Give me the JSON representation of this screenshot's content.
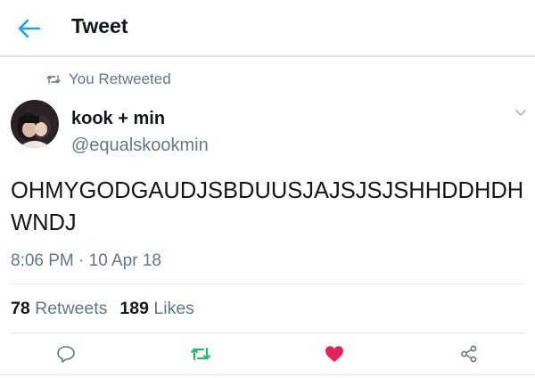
{
  "header": {
    "title": "Tweet",
    "back_icon": "arrow-left-icon"
  },
  "retweet_context": {
    "text": "You Retweeted",
    "icon": "retweet-icon"
  },
  "author": {
    "display_name": "kook + min",
    "handle": "@equalskookmin"
  },
  "tweet": {
    "text": "OHMYGODGAUDJSBDUUSJAJSJSJSHHDDHDHWNDJ",
    "timestamp": "8:06 PM · 10 Apr 18"
  },
  "stats": {
    "retweets_count": "78",
    "retweets_label": "Retweets",
    "likes_count": "189",
    "likes_label": "Likes"
  },
  "actions": [
    {
      "name": "reply",
      "icon": "reply-icon",
      "active": false
    },
    {
      "name": "retweet",
      "icon": "retweet-icon",
      "active": true
    },
    {
      "name": "like",
      "icon": "heart-icon",
      "active": true
    },
    {
      "name": "share",
      "icon": "share-icon",
      "active": false
    }
  ],
  "colors": {
    "accent": "#1da1f2",
    "retweet_green": "#17bf63",
    "like_red": "#e0245e",
    "secondary_text": "#657786"
  }
}
